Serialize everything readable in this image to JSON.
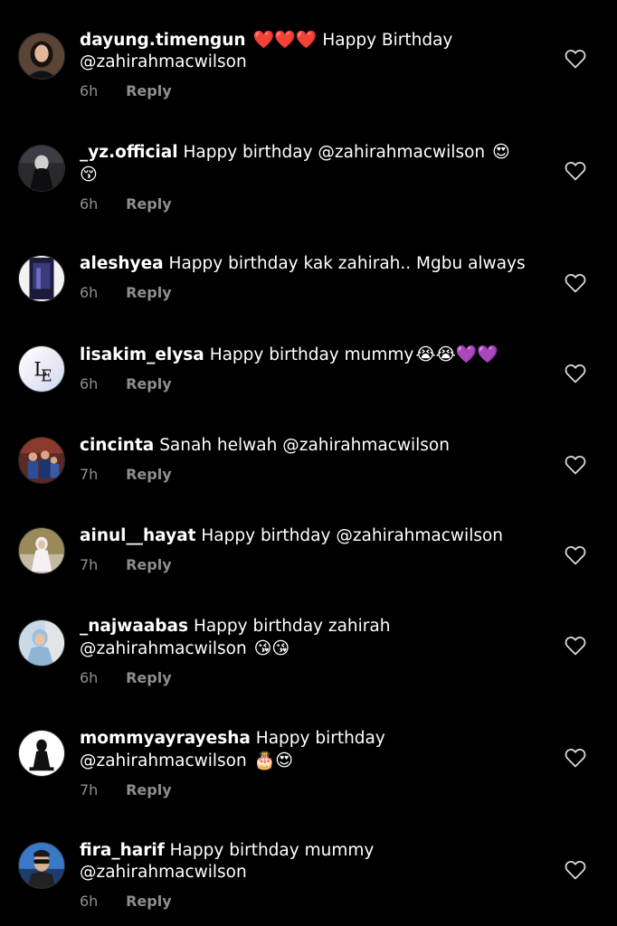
{
  "colors": {
    "background": "#000000",
    "text": "#ffffff",
    "muted": "#8e8e8e"
  },
  "comments": [
    {
      "username": "dayung.timengun",
      "text": "Happy Birthday @zahirahmacwilson",
      "emoji_before": "❤️❤️❤️",
      "emoji_after": "",
      "time": "6h",
      "reply_label": "Reply",
      "avatar_icon": "profile-photo-woman-dark-hair"
    },
    {
      "username": "_yz.official",
      "text": "Happy birthday @zahirahmacwilson",
      "emoji_before": "",
      "emoji_after": "😍 😚",
      "time": "6h",
      "reply_label": "Reply",
      "avatar_icon": "profile-photo-dark-figure"
    },
    {
      "username": "aleshyea",
      "text": "Happy birthday kak zahirah.. Mgbu always",
      "emoji_before": "",
      "emoji_after": "",
      "time": "6h",
      "reply_label": "Reply",
      "avatar_icon": "profile-photo-night-scene"
    },
    {
      "username": "lisakim_elysa",
      "text": "Happy birthday mummy",
      "emoji_before": "",
      "emoji_after": "😭😭💜💜",
      "time": "6h",
      "reply_label": "Reply",
      "avatar_icon": "profile-logo-le"
    },
    {
      "username": "cincinta",
      "text": "Sanah helwah @zahirahmacwilson",
      "emoji_before": "",
      "emoji_after": "",
      "time": "7h",
      "reply_label": "Reply",
      "avatar_icon": "profile-photo-family"
    },
    {
      "username": "ainul__hayat",
      "text": "Happy birthday @zahirahmacwilson",
      "emoji_before": "",
      "emoji_after": "",
      "time": "7h",
      "reply_label": "Reply",
      "avatar_icon": "profile-photo-woman-hijab"
    },
    {
      "username": "_najwaabas",
      "text": "Happy birthday zahirah @zahirahmacwilson",
      "emoji_before": "",
      "emoji_after": "😘😘",
      "time": "6h",
      "reply_label": "Reply",
      "avatar_icon": "profile-photo-woman-smiling"
    },
    {
      "username": "mommyayrayesha",
      "text": "Happy birthday @zahirahmacwilson",
      "emoji_before": "",
      "emoji_after": "🎂😍",
      "time": "7h",
      "reply_label": "Reply",
      "avatar_icon": "profile-photo-silhouette"
    },
    {
      "username": "fira_harif",
      "text": "Happy birthday mummy @zahirahmacwilson",
      "emoji_before": "",
      "emoji_after": "",
      "time": "6h",
      "reply_label": "Reply",
      "avatar_icon": "profile-photo-person-sunglasses"
    }
  ]
}
